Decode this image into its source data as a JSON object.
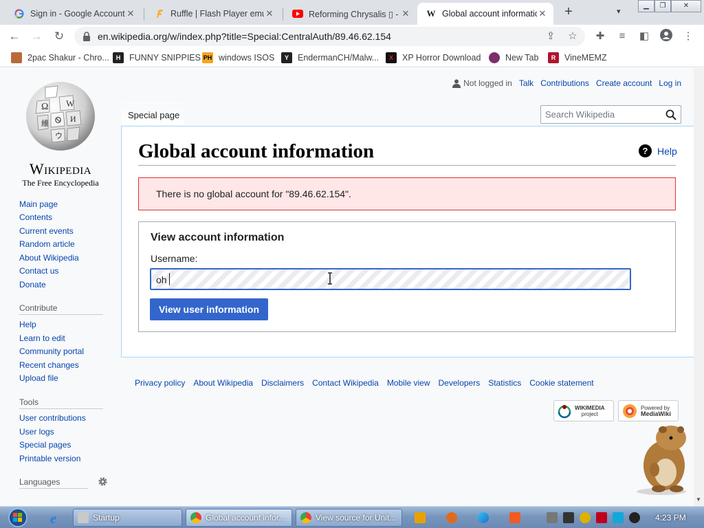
{
  "browser": {
    "tabs": [
      {
        "title": "Sign in - Google Accounts",
        "favicon": "google-icon",
        "active": false
      },
      {
        "title": "Ruffle | Flash Player emulator",
        "favicon": "ruffle-icon",
        "active": false
      },
      {
        "title": "Reforming Chrysalis ▯ - YouTube",
        "favicon": "youtube-icon",
        "active": false
      },
      {
        "title": "Global account information",
        "favicon": "wikipedia-icon",
        "active": true
      }
    ],
    "new_tab": "+",
    "url": "en.wikipedia.org/w/index.php?title=Special:CentralAuth/89.46.62.154",
    "bookmarks": [
      {
        "label": "2pac Shakur - Chro...",
        "icon": "bookmark-icon"
      },
      {
        "label": "FUNNY SNIPPIES",
        "icon": "bookmark-icon"
      },
      {
        "label": "windows ISOS",
        "icon": "bookmark-icon"
      },
      {
        "label": "EndermanCH/Malw...",
        "icon": "bookmark-icon"
      },
      {
        "label": "XP Horror Download",
        "icon": "bookmark-icon"
      },
      {
        "label": "New Tab",
        "icon": "bookmark-icon"
      },
      {
        "label": "VineMEMZ",
        "icon": "bookmark-icon"
      }
    ]
  },
  "wiki": {
    "logo": {
      "wordmark": "Wikipedia",
      "tagline": "The Free Encyclopedia"
    },
    "personal": {
      "not_logged_in": "Not logged in",
      "talk": "Talk",
      "contributions": "Contributions",
      "create_account": "Create account",
      "login": "Log in"
    },
    "tab_special": "Special page",
    "search_placeholder": "Search Wikipedia",
    "nav": [
      "Main page",
      "Contents",
      "Current events",
      "Random article",
      "About Wikipedia",
      "Contact us",
      "Donate"
    ],
    "contribute_heading": "Contribute",
    "contribute": [
      "Help",
      "Learn to edit",
      "Community portal",
      "Recent changes",
      "Upload file"
    ],
    "tools_heading": "Tools",
    "tools": [
      "User contributions",
      "User logs",
      "Special pages",
      "Printable version"
    ],
    "languages_heading": "Languages",
    "title": "Global account information",
    "help": "Help",
    "error": "There is no global account for \"89.46.62.154\".",
    "form": {
      "legend": "View account information",
      "username_label": "Username:",
      "username_value": "oh",
      "button": "View user information"
    },
    "footer_links": [
      "Privacy policy",
      "About Wikipedia",
      "Disclaimers",
      "Contact Wikipedia",
      "Mobile view",
      "Developers",
      "Statistics",
      "Cookie statement"
    ],
    "badges": {
      "wikimedia_top": "WIKIMEDIA",
      "wikimedia_bottom": "project",
      "mediawiki_top": "Powered by",
      "mediawiki_bottom": "MediaWiki"
    }
  },
  "taskbar": {
    "items": [
      {
        "label": "Startup"
      },
      {
        "label": "Global account infor..."
      },
      {
        "label": "View source for Unit..."
      }
    ],
    "clock": "4:23 PM"
  },
  "colors": {
    "link": "#0645ad",
    "error_bg": "#fee7e6",
    "error_border": "#dd3333",
    "primary_button": "#3366cc"
  }
}
